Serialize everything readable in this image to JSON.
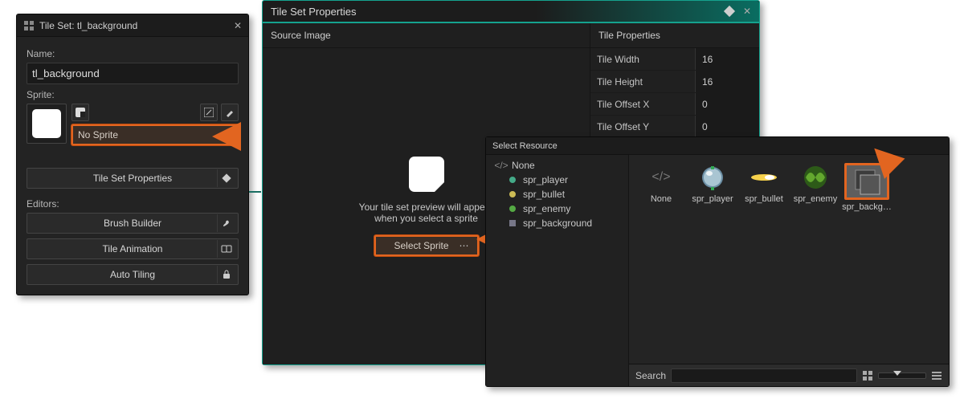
{
  "tilesetPanel": {
    "title": "Tile Set: tl_background",
    "nameLabel": "Name:",
    "nameValue": "tl_background",
    "spriteLabel": "Sprite:",
    "noSpriteLabel": "No Sprite",
    "propsBtn": "Tile Set Properties",
    "editorsLabel": "Editors:",
    "brushBtn": "Brush Builder",
    "animBtn": "Tile Animation",
    "autoBtn": "Auto Tiling"
  },
  "propertiesPanel": {
    "title": "Tile Set Properties",
    "sourceLabel": "Source Image",
    "previewLine1": "Your tile set preview will appear",
    "previewLine2": "when you select a sprite",
    "selectSpriteBtn": "Select Sprite",
    "tilePropsLabel": "Tile Properties",
    "props": [
      {
        "label": "Tile Width",
        "value": "16"
      },
      {
        "label": "Tile Height",
        "value": "16"
      },
      {
        "label": "Tile Offset X",
        "value": "0"
      },
      {
        "label": "Tile Offset Y",
        "value": "0"
      }
    ]
  },
  "resourceDialog": {
    "title": "Select Resource",
    "tree": {
      "none": "None",
      "items": [
        {
          "name": "spr_player"
        },
        {
          "name": "spr_bullet"
        },
        {
          "name": "spr_enemy"
        },
        {
          "name": "spr_background"
        }
      ]
    },
    "thumbs": [
      {
        "label": "None"
      },
      {
        "label": "spr_player"
      },
      {
        "label": "spr_bullet"
      },
      {
        "label": "spr_enemy"
      },
      {
        "label": "spr_backg…"
      }
    ],
    "searchLabel": "Search"
  }
}
